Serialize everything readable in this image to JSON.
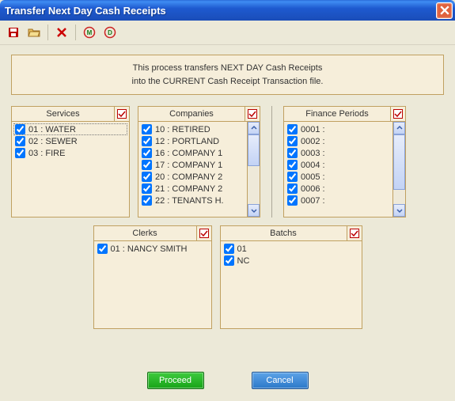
{
  "window": {
    "title": "Transfer Next Day Cash Receipts"
  },
  "info": {
    "line1": "This process transfers NEXT DAY Cash Receipts",
    "line2": "into the CURRENT Cash Receipt Transaction file."
  },
  "groups": {
    "services": {
      "title": "Services",
      "items": [
        {
          "label": "01 : WATER",
          "checked": true
        },
        {
          "label": "02 : SEWER",
          "checked": true
        },
        {
          "label": "03 : FIRE",
          "checked": true
        }
      ]
    },
    "companies": {
      "title": "Companies",
      "items": [
        {
          "label": "10 : RETIRED",
          "checked": true
        },
        {
          "label": "12 : PORTLAND",
          "checked": true
        },
        {
          "label": "16 : COMPANY 1",
          "checked": true
        },
        {
          "label": "17 : COMPANY 1",
          "checked": true
        },
        {
          "label": "20 : COMPANY 2",
          "checked": true
        },
        {
          "label": "21 : COMPANY 2",
          "checked": true
        },
        {
          "label": "22 : TENANTS H.",
          "checked": true
        }
      ]
    },
    "finance_periods": {
      "title": "Finance Periods",
      "items": [
        {
          "label": "0001 :",
          "checked": true
        },
        {
          "label": "0002 :",
          "checked": true
        },
        {
          "label": "0003 :",
          "checked": true
        },
        {
          "label": "0004 :",
          "checked": true
        },
        {
          "label": "0005 :",
          "checked": true
        },
        {
          "label": "0006 :",
          "checked": true
        },
        {
          "label": "0007 :",
          "checked": true
        }
      ]
    },
    "clerks": {
      "title": "Clerks",
      "items": [
        {
          "label": "01   : NANCY SMITH",
          "checked": true
        }
      ]
    },
    "batchs": {
      "title": "Batchs",
      "items": [
        {
          "label": "01",
          "checked": true
        },
        {
          "label": "NC",
          "checked": true
        }
      ]
    }
  },
  "buttons": {
    "proceed": "Proceed",
    "cancel": "Cancel"
  }
}
